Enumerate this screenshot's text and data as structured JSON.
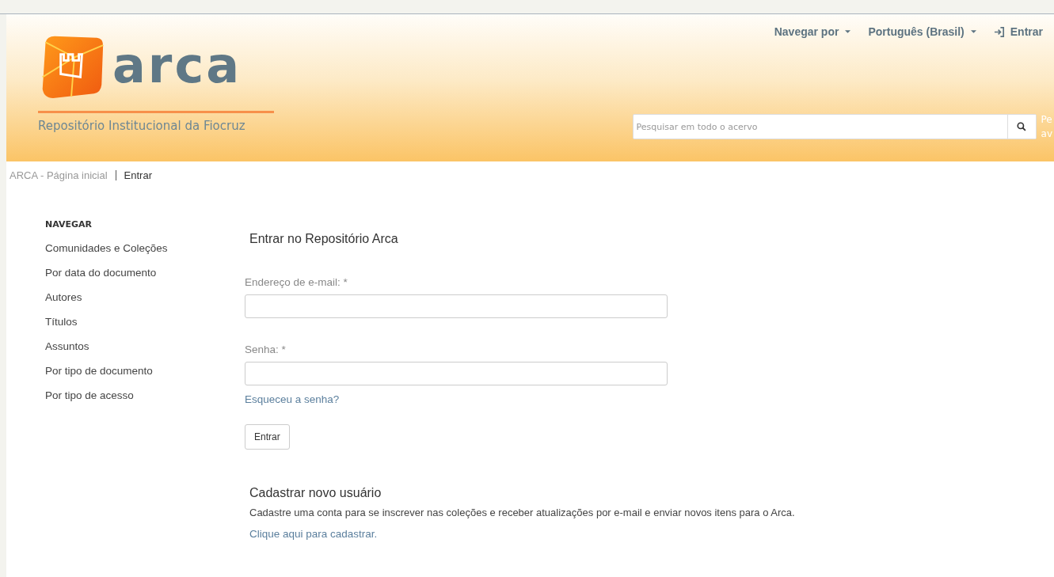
{
  "header": {
    "logo_word": "arca",
    "tagline": "Repositório Institucional da Fiocruz",
    "nav": [
      {
        "label": "Navegar por",
        "kind": "dropdown"
      },
      {
        "label": "Português (Brasil)",
        "kind": "dropdown"
      },
      {
        "label": "Entrar",
        "kind": "login"
      }
    ],
    "search": {
      "placeholder": "Pesquisar em todo o acervo"
    },
    "side_text": [
      "Pe",
      "av"
    ]
  },
  "breadcrumb": [
    {
      "label": "ARCA - Página inicial",
      "selected": false
    },
    {
      "label": "Entrar",
      "selected": true
    }
  ],
  "sidebar": {
    "title": "NAVEGAR",
    "items": [
      "Comunidades e Coleções",
      "Por data do documento",
      "Autores",
      "Títulos",
      "Assuntos",
      "Por tipo de documento",
      "Por tipo de acesso"
    ]
  },
  "login": {
    "title": "Entrar no Repositório Arca",
    "fields": [
      {
        "label": "Endereço de e-mail: *"
      },
      {
        "label": "Senha: *"
      }
    ],
    "forgot": "Esqueceu a senha?",
    "button": "Entrar"
  },
  "register": {
    "title": "Cadastrar novo usuário",
    "text": "Cadastre uma conta para se inscrever nas coleções e receber atualizações por e-mail e enviar novos itens para o Arca.",
    "link": "Clique aqui para cadastrar."
  }
}
